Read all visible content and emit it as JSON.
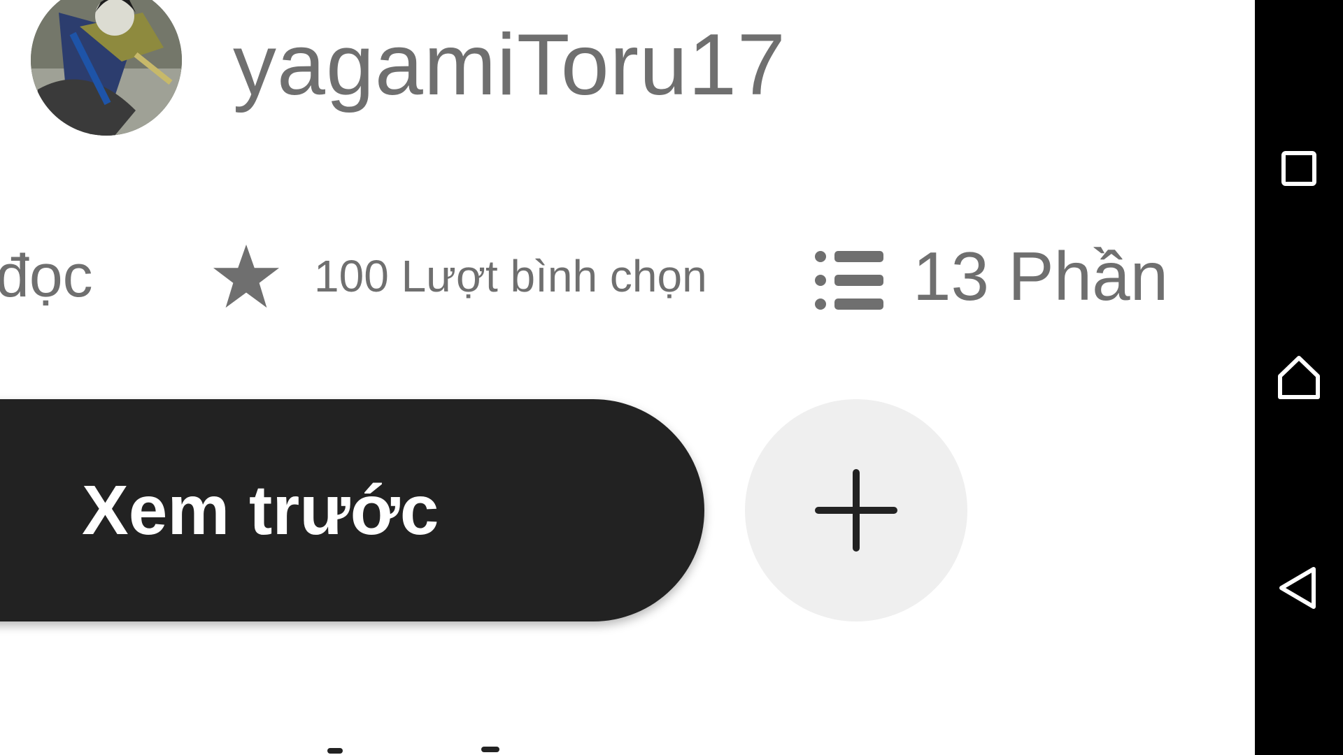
{
  "author": {
    "name": "yagamiToru17",
    "avatar_icon": "avatar-image"
  },
  "stats": {
    "reads_label": "đọc",
    "votes_label": "100 Lượt bình chọn",
    "votes_icon": "star-icon",
    "parts_label": "13 Phần",
    "parts_icon": "list-icon"
  },
  "actions": {
    "read_label": "Xem trước",
    "add_icon": "plus-icon"
  },
  "navbar": {
    "recent_icon": "recent-apps-icon",
    "home_icon": "home-icon",
    "back_icon": "back-icon"
  },
  "colors": {
    "text_gray": "#6f6f6f",
    "button_dark": "#222222",
    "add_bg": "#efefef",
    "navbar_bg": "#000000"
  }
}
